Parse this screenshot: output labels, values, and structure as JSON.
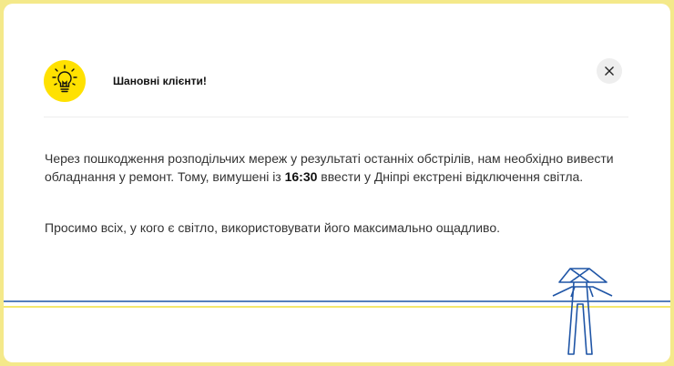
{
  "dialog": {
    "title": "Шановні клієнти!",
    "icon": "lightbulb-icon",
    "close_icon": "close-icon",
    "paragraph1": {
      "before": "Через пошкодження розподільчих мереж у результаті останніх обстрілів, нам необхідно вивести обладнання у ремонт. Тому, вимушені із ",
      "time": "16:30",
      "after": " ввести у Дніпрі екстрені відключення світла."
    },
    "paragraph2": "Просимо всіх, у кого є світло, використовувати його максимально ощадливо."
  },
  "colors": {
    "accent_yellow": "#ffe100",
    "frame_yellow": "#f4e98a",
    "line_blue": "#1f55a6"
  }
}
